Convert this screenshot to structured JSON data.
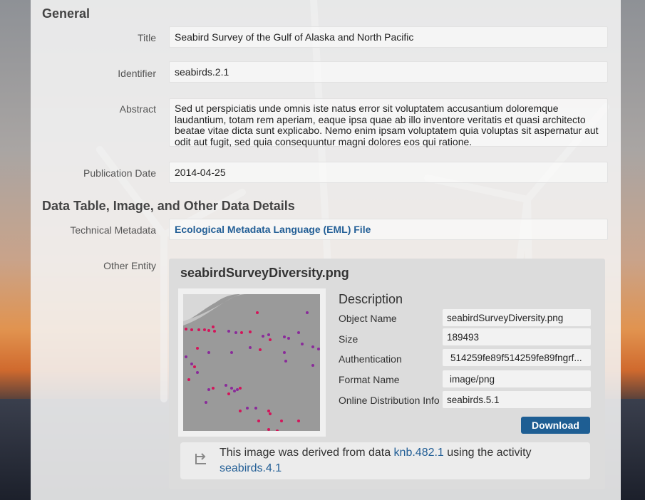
{
  "general": {
    "heading": "General",
    "title_label": "Title",
    "title_value": "Seabird Survey of the Gulf of Alaska and North Pacific",
    "identifier_label": "Identifier",
    "identifier_value": "seabirds.2.1",
    "abstract_label": "Abstract",
    "abstract_value": "Sed ut perspiciatis unde omnis iste natus error sit voluptatem accusantium doloremque laudantium, totam rem aperiam, eaque ipsa quae ab illo inventore veritatis et quasi architecto beatae vitae dicta sunt explicabo. Nemo enim ipsam voluptatem quia voluptas sit aspernatur aut odit aut fugit, sed quia consequuntur magni dolores eos qui ratione.",
    "pubdate_label": "Publication Date",
    "pubdate_value": "2014-04-25"
  },
  "details": {
    "heading": "Data Table, Image, and Other Data Details",
    "techmeta_label": "Technical Metadata",
    "techmeta_link": "Ecological Metadata Language (EML) File",
    "other_entity_label": "Other Entity"
  },
  "entity": {
    "title": "seabirdSurveyDiversity.png",
    "description_heading": "Description",
    "object_name_label": "Object Name",
    "object_name_value": "seabirdSurveyDiversity.png",
    "size_label": "Size",
    "size_value": "189493",
    "auth_label": "Authentication",
    "auth_value": "514259fe89f514259fe89fngrf...",
    "format_label": "Format Name",
    "format_value": "image/png",
    "online_label": "Online Distribution Info",
    "online_value": "seabirds.5.1",
    "download_label": "Download",
    "provenance": {
      "text_before": "This image was derived from data ",
      "data_link": "knb.482.1",
      "text_middle": " using the activity ",
      "activity_link": "seabirds.4.1"
    }
  },
  "colors": {
    "link": "#235f96",
    "download_button": "#1e5e93",
    "dot_red": "#d4145a",
    "dot_purple": "#8a2b9a"
  }
}
